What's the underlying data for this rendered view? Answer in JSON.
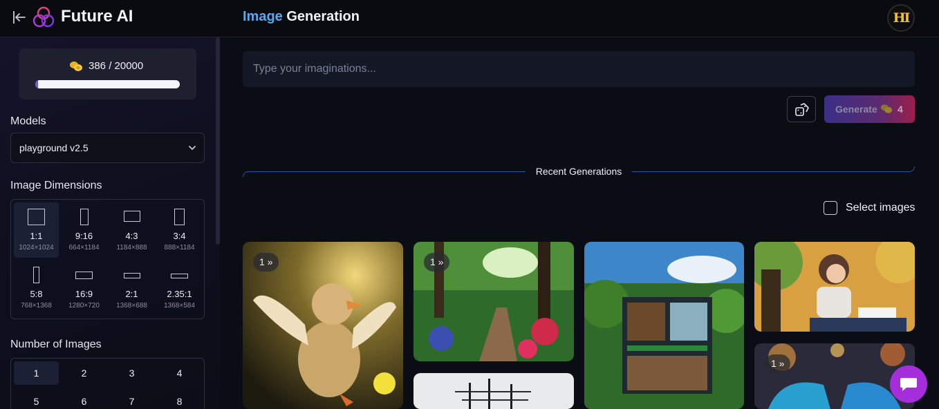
{
  "header": {
    "brand": "Future AI",
    "title_part1": "Image",
    "title_part2": "Generation",
    "avatar_text": "HI"
  },
  "credits": {
    "text": "386 / 20000",
    "used_fraction": 0.019
  },
  "models": {
    "label": "Models",
    "selected": "playground v2.5"
  },
  "dimensions": {
    "label": "Image Dimensions",
    "options": [
      {
        "ratio": "1:1",
        "size": "1024×1024"
      },
      {
        "ratio": "9:16",
        "size": "664×1184"
      },
      {
        "ratio": "4:3",
        "size": "1184×888"
      },
      {
        "ratio": "3:4",
        "size": "888×1184"
      },
      {
        "ratio": "5:8",
        "size": "768×1368"
      },
      {
        "ratio": "16:9",
        "size": "1280×720"
      },
      {
        "ratio": "2:1",
        "size": "1368×688"
      },
      {
        "ratio": "2.35:1",
        "size": "1368×584"
      }
    ],
    "selected": "1:1"
  },
  "number_of_images": {
    "label": "Number of Images",
    "options": [
      "1",
      "2",
      "3",
      "4",
      "5",
      "6",
      "7",
      "8"
    ],
    "selected": "1"
  },
  "prompt": {
    "placeholder": "Type your imaginations..."
  },
  "generate": {
    "label": "Generate",
    "cost": "4"
  },
  "recent": {
    "title": "Recent Generations",
    "select_label": "Select images",
    "badges": [
      "1 »",
      "1 »",
      "1 »"
    ]
  },
  "colors": {
    "accent_blue": "#5aa8ef",
    "progress": "#6a5ae0",
    "chat": "#a42ed9"
  },
  "icons": [
    "back-arrow-icon",
    "logo-icon",
    "coin-icon",
    "chevron-down-icon",
    "dice-icon",
    "chat-icon"
  ]
}
